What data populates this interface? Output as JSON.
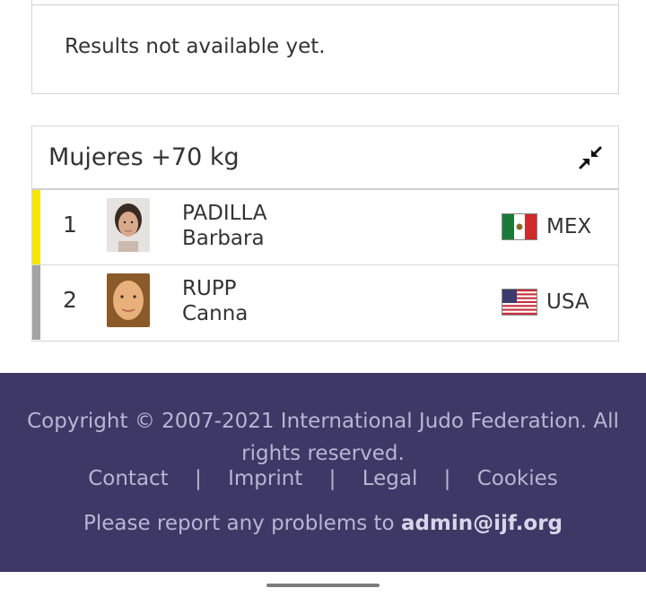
{
  "top_card": {
    "message": "Results not available yet."
  },
  "results": {
    "title": "Mujeres +70 kg",
    "rows": [
      {
        "rank": "1",
        "surname": "PADILLA",
        "given": "Barbara",
        "nation": "MEX",
        "medal_color": "#f5e600",
        "flag": "mexico-flag"
      },
      {
        "rank": "2",
        "surname": "RUPP",
        "given": "Canna",
        "nation": "USA",
        "medal_color": "#a3a3a3",
        "flag": "usa-flag"
      }
    ]
  },
  "footer": {
    "copyright": "Copyright © 2007-2021 International Judo Federation. All rights reserved.",
    "links": [
      "Contact",
      "Imprint",
      "Legal",
      "Cookies"
    ],
    "separator": "|",
    "report_prefix": "Please report any problems to",
    "report_email": "admin@ijf.org",
    "background": "#3d3865"
  }
}
